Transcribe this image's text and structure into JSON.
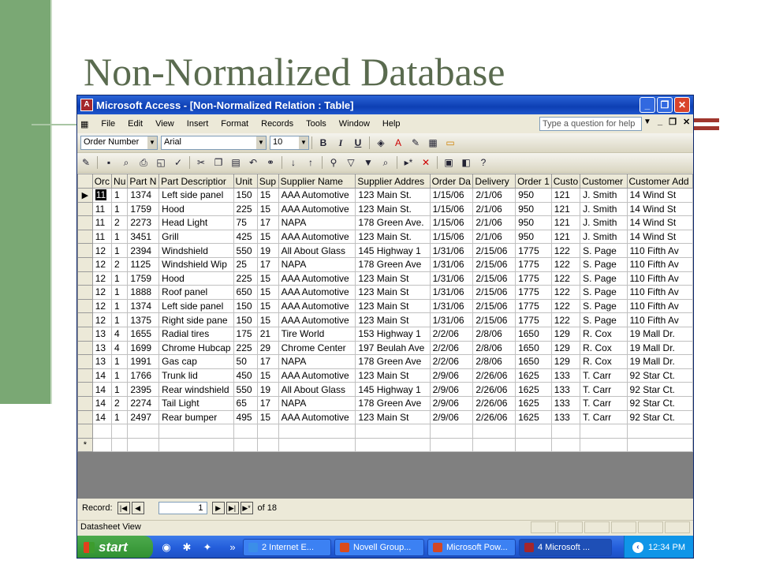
{
  "slide": {
    "title": "Non-Normalized Database"
  },
  "window": {
    "title": "Microsoft Access - [Non-Normalized Relation : Table]",
    "app_icon_letter": "A",
    "minimize": "_",
    "maximize": "❐",
    "close": "✕"
  },
  "menubar": {
    "items": [
      "File",
      "Edit",
      "View",
      "Insert",
      "Format",
      "Records",
      "Tools",
      "Window",
      "Help"
    ],
    "help_placeholder": "Type a question for help",
    "mdi_min": "_",
    "mdi_restore": "❐",
    "mdi_close": "✕"
  },
  "formatting_toolbar": {
    "field_select": "Order Number",
    "font": "Arial",
    "size": "10",
    "bold": "B",
    "italic": "I",
    "underline": "U"
  },
  "table": {
    "columns": [
      "Orc",
      "Nu",
      "Part N",
      "Part Descriptior",
      "Unit",
      "Sup",
      "Supplier Name",
      "Supplier Addres",
      "Order Da",
      "Delivery",
      "Order 1",
      "Custo",
      "Customer",
      "Customer Add"
    ],
    "rows": [
      [
        "11",
        "1",
        "1374",
        "Left side panel",
        "150",
        "15",
        "AAA Automotive",
        "123 Main St.",
        "1/15/06",
        "2/1/06",
        "950",
        "121",
        "J. Smith",
        "14 Wind St"
      ],
      [
        "11",
        "1",
        "1759",
        "Hood",
        "225",
        "15",
        "AAA Automotive",
        "123 Main St.",
        "1/15/06",
        "2/1/06",
        "950",
        "121",
        "J. Smith",
        "14 Wind St"
      ],
      [
        "11",
        "2",
        "2273",
        "Head Light",
        "75",
        "17",
        "NAPA",
        "178 Green Ave.",
        "1/15/06",
        "2/1/06",
        "950",
        "121",
        "J. Smith",
        "14 Wind St"
      ],
      [
        "11",
        "1",
        "3451",
        "Grill",
        "425",
        "15",
        "AAA Automotive",
        "123 Main St.",
        "1/15/06",
        "2/1/06",
        "950",
        "121",
        "J. Smith",
        "14 Wind St"
      ],
      [
        "12",
        "1",
        "2394",
        "Windshield",
        "550",
        "19",
        "All About Glass",
        "145 Highway 1",
        "1/31/06",
        "2/15/06",
        "1775",
        "122",
        "S. Page",
        "110 Fifth Av"
      ],
      [
        "12",
        "2",
        "1125",
        "Windshield Wip",
        "25",
        "17",
        "NAPA",
        "178 Green Ave",
        "1/31/06",
        "2/15/06",
        "1775",
        "122",
        "S. Page",
        "110 Fifth Av"
      ],
      [
        "12",
        "1",
        "1759",
        "Hood",
        "225",
        "15",
        "AAA Automotive",
        "123 Main St",
        "1/31/06",
        "2/15/06",
        "1775",
        "122",
        "S. Page",
        "110 Fifth Av"
      ],
      [
        "12",
        "1",
        "1888",
        "Roof panel",
        "650",
        "15",
        "AAA Automotive",
        "123 Main St",
        "1/31/06",
        "2/15/06",
        "1775",
        "122",
        "S. Page",
        "110 Fifth Av"
      ],
      [
        "12",
        "1",
        "1374",
        "Left side panel",
        "150",
        "15",
        "AAA Automotive",
        "123 Main St",
        "1/31/06",
        "2/15/06",
        "1775",
        "122",
        "S. Page",
        "110 Fifth Av"
      ],
      [
        "12",
        "1",
        "1375",
        "Right side pane",
        "150",
        "15",
        "AAA Automotive",
        "123 Main St",
        "1/31/06",
        "2/15/06",
        "1775",
        "122",
        "S. Page",
        "110 Fifth Av"
      ],
      [
        "13",
        "4",
        "1655",
        "Radial tires",
        "175",
        "21",
        "Tire World",
        "153 Highway 1",
        "2/2/06",
        "2/8/06",
        "1650",
        "129",
        "R. Cox",
        "19 Mall Dr."
      ],
      [
        "13",
        "4",
        "1699",
        "Chrome Hubcap",
        "225",
        "29",
        "Chrome Center",
        "197 Beulah Ave",
        "2/2/06",
        "2/8/06",
        "1650",
        "129",
        "R. Cox",
        "19 Mall Dr."
      ],
      [
        "13",
        "1",
        "1991",
        "Gas cap",
        "50",
        "17",
        "NAPA",
        "178 Green Ave",
        "2/2/06",
        "2/8/06",
        "1650",
        "129",
        "R. Cox",
        "19 Mall Dr."
      ],
      [
        "14",
        "1",
        "1766",
        "Trunk lid",
        "450",
        "15",
        "AAA Automotive",
        "123 Main St",
        "2/9/06",
        "2/26/06",
        "1625",
        "133",
        "T. Carr",
        "92 Star Ct."
      ],
      [
        "14",
        "1",
        "2395",
        "Rear windshield",
        "550",
        "19",
        "All About Glass",
        "145 Highway 1",
        "2/9/06",
        "2/26/06",
        "1625",
        "133",
        "T. Carr",
        "92 Star Ct."
      ],
      [
        "14",
        "2",
        "2274",
        "Tail Light",
        "65",
        "17",
        "NAPA",
        "178 Green Ave",
        "2/9/06",
        "2/26/06",
        "1625",
        "133",
        "T. Carr",
        "92 Star Ct."
      ],
      [
        "14",
        "1",
        "2497",
        "Rear bumper",
        "495",
        "15",
        "AAA Automotive",
        "123 Main St",
        "2/9/06",
        "2/26/06",
        "1625",
        "133",
        "T. Carr",
        "92 Star Ct."
      ]
    ],
    "current_row_marker": "▶",
    "new_row_marker": "*"
  },
  "record_nav": {
    "label": "Record:",
    "first": "|◀",
    "prev": "◀",
    "current": "1",
    "next": "▶",
    "last": "▶|",
    "new": "▶*",
    "of_text": "of 18"
  },
  "status": {
    "text": "Datasheet View"
  },
  "taskbar": {
    "start": "start",
    "tasks": [
      {
        "label": "2 Internet E...",
        "icon_color": "#3b8ee8"
      },
      {
        "label": "Novell Group...",
        "icon_color": "#d94b1c"
      },
      {
        "label": "Microsoft Pow...",
        "icon_color": "#d24726"
      },
      {
        "label": "4 Microsoft ...",
        "icon_color": "#a4262c"
      }
    ],
    "clock": "12:34 PM"
  }
}
